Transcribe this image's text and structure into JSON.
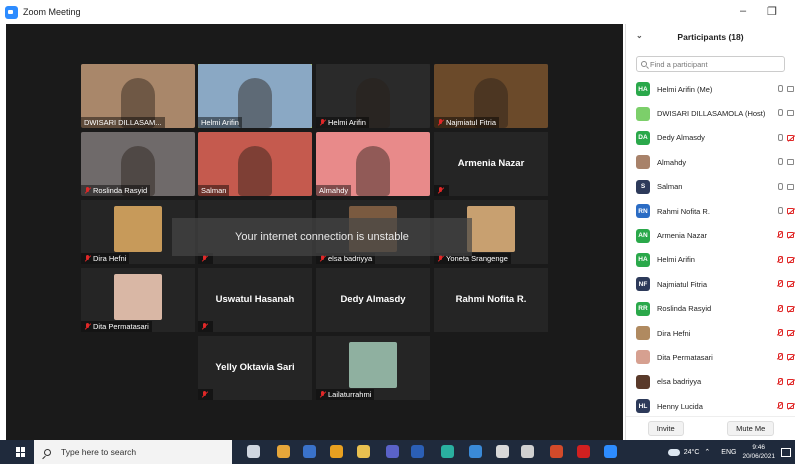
{
  "window": {
    "title": "Zoom Meeting",
    "minimize": "–",
    "restore": "❐"
  },
  "stage": {
    "warning": "Your internet connection is unstable"
  },
  "tiles": [
    {
      "name": "DWISARI DILLASAM...",
      "muted": false,
      "type": "photo",
      "bg": "#a9876a"
    },
    {
      "name": "Helmi Arifin",
      "muted": false,
      "type": "photo",
      "bg": "#8aa8c4",
      "active": true
    },
    {
      "name": "Helmi Arifin",
      "muted": true,
      "type": "photo",
      "bg": "#2a2a2a"
    },
    {
      "name": "Najmiatul Fitria",
      "muted": true,
      "type": "photo",
      "bg": "#6b4a2a"
    },
    {
      "name": "Roslinda Rasyid",
      "muted": true,
      "type": "photo",
      "bg": "#6f6a6a"
    },
    {
      "name": "Salman",
      "muted": false,
      "type": "photo",
      "bg": "#c55a4e"
    },
    {
      "name": "Almahdy",
      "muted": false,
      "type": "photo",
      "bg": "#e88a8a"
    },
    {
      "name": "",
      "muted": true,
      "type": "label",
      "label": "Armenia Nazar"
    },
    {
      "name": "Dira Hefni",
      "muted": true,
      "type": "small",
      "bg": "#c79a5a"
    },
    {
      "name": "",
      "muted": true,
      "type": "blank"
    },
    {
      "name": "elsa badriyya",
      "muted": true,
      "type": "small",
      "bg": "#7a5a40"
    },
    {
      "name": "Yoneta Srangenge",
      "muted": true,
      "type": "small",
      "bg": "#c8a070"
    },
    {
      "name": "Dita Permatasari",
      "muted": true,
      "type": "small",
      "bg": "#d9b7a5"
    },
    {
      "name": "",
      "muted": true,
      "type": "label",
      "label": "Uswatul Hasanah"
    },
    {
      "name": "",
      "muted": false,
      "type": "label",
      "label": "Dedy Almasdy"
    },
    {
      "name": "",
      "muted": false,
      "type": "label",
      "label": "Rahmi Nofita R."
    },
    {
      "name": "",
      "muted": true,
      "type": "label",
      "label": "Yelly Oktavia Sari"
    },
    {
      "name": "Lailaturrahmi",
      "muted": true,
      "type": "small",
      "bg": "#8fb0a0"
    }
  ],
  "panel": {
    "title": "Participants (18)",
    "search_placeholder": "Find a participant",
    "invite": "Invite",
    "mute_me": "Mute Me",
    "participants": [
      {
        "initials": "HA",
        "color": "#2aa84a",
        "name": "Helmi Arifin (Me)",
        "mic": "on",
        "cam": "on"
      },
      {
        "initials": "",
        "color": "#7ccf6a",
        "name": "DWISARI DILLASAMOLA (Host)",
        "mic": "on",
        "cam": "on"
      },
      {
        "initials": "DA",
        "color": "#2aa84a",
        "name": "Dedy Almasdy",
        "mic": "on",
        "cam": "off"
      },
      {
        "initials": "",
        "color": "#a8826a",
        "name": "Almahdy",
        "mic": "on",
        "cam": "on"
      },
      {
        "initials": "S",
        "color": "#2d3a5a",
        "name": "Salman",
        "mic": "on",
        "cam": "on"
      },
      {
        "initials": "RN",
        "color": "#2b6cc4",
        "name": "Rahmi Nofita R.",
        "mic": "on",
        "cam": "off"
      },
      {
        "initials": "AN",
        "color": "#2aa84a",
        "name": "Armenia Nazar",
        "mic": "off",
        "cam": "off"
      },
      {
        "initials": "HA",
        "color": "#2aa84a",
        "name": "Helmi Arifin",
        "mic": "off",
        "cam": "off"
      },
      {
        "initials": "NF",
        "color": "#2d3a5a",
        "name": "Najmiatul Fitria",
        "mic": "off",
        "cam": "off"
      },
      {
        "initials": "RR",
        "color": "#2aa84a",
        "name": "Roslinda Rasyid",
        "mic": "off",
        "cam": "off"
      },
      {
        "initials": "",
        "color": "#b08a60",
        "name": "Dira Hefni",
        "mic": "off",
        "cam": "off"
      },
      {
        "initials": "",
        "color": "#d6a090",
        "name": "Dita Permatasari",
        "mic": "off",
        "cam": "off"
      },
      {
        "initials": "",
        "color": "#5a3a2a",
        "name": "elsa badriyya",
        "mic": "off",
        "cam": "off"
      },
      {
        "initials": "HL",
        "color": "#2d3a5a",
        "name": "Henny Lucida",
        "mic": "off",
        "cam": "off"
      }
    ]
  },
  "taskbar": {
    "search_placeholder": "Type here to search",
    "weather": "24°C",
    "lang": "ENG",
    "time": "9:46",
    "date": "20/06/2021",
    "apps": [
      {
        "icon": "task-view-icon",
        "color": "#cfd6e0"
      },
      {
        "icon": "chrome-icon",
        "color": "#e6a63a"
      },
      {
        "icon": "file-explorer-icon",
        "color": "#3a72c9"
      },
      {
        "icon": "search-app-icon",
        "color": "#e8a020"
      },
      {
        "icon": "folder-icon",
        "color": "#e8c050"
      },
      {
        "icon": "teams-icon",
        "color": "#5a62c8"
      },
      {
        "icon": "word-icon",
        "color": "#2b5fb5"
      },
      {
        "icon": "edge-icon",
        "color": "#2ab0a0"
      },
      {
        "icon": "mail-icon",
        "color": "#3a8ad8"
      },
      {
        "icon": "store-icon",
        "color": "#d8d8d8"
      },
      {
        "icon": "camera-icon",
        "color": "#d0d0d0"
      },
      {
        "icon": "powerpoint-icon",
        "color": "#d24a2a"
      },
      {
        "icon": "acrobat-icon",
        "color": "#d02020"
      },
      {
        "icon": "zoom-icon",
        "color": "#2d8cff"
      }
    ]
  }
}
